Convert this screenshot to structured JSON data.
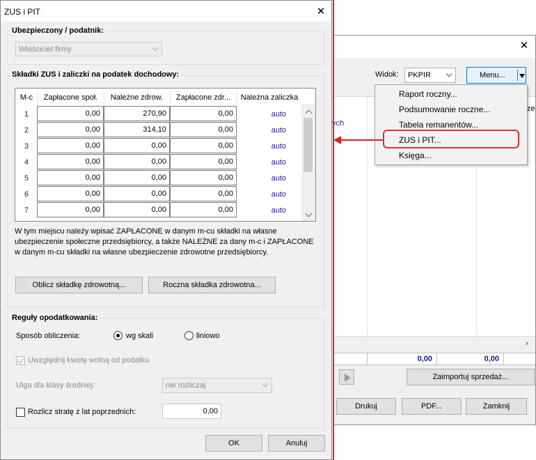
{
  "bg_window": {
    "close": "✕",
    "view_label": "Widok:",
    "view_value": "PKPIR",
    "menu_button": "Menu...",
    "menu_items": [
      "Raport roczny...",
      "Podsumowanie roczne...",
      "Tabela remanentów...",
      "ZUS i PIT...",
      "Księga..."
    ],
    "partial_text": "ych",
    "partial_text2": "ze",
    "sum1": "0,00",
    "sum2": "0,00",
    "import_button": "Zaimportuj sprzedaż...",
    "print_button": "Drukuj",
    "pdf_button": "PDF...",
    "close_button": "Zamknij"
  },
  "dialog": {
    "title": "ZUS i PIT",
    "close": "✕",
    "insured": {
      "group_title": "Ubezpieczony / podatnik:",
      "selected": "Właściciel firmy"
    },
    "contributions": {
      "group_title": "Składki ZUS i zaliczki na podatek dochodowy:",
      "columns": [
        "M-c",
        "Zapłacone społ.",
        "Należne zdrow.",
        "Zapłacone zdr...",
        "Należna zaliczka"
      ],
      "rows": [
        {
          "month": "1",
          "paid_social": "0,00",
          "due_health": "270,90",
          "paid_health": "0,00",
          "advance": "auto"
        },
        {
          "month": "2",
          "paid_social": "0,00",
          "due_health": "314,10",
          "paid_health": "0,00",
          "advance": "auto"
        },
        {
          "month": "3",
          "paid_social": "0,00",
          "due_health": "0,00",
          "paid_health": "0,00",
          "advance": "auto"
        },
        {
          "month": "4",
          "paid_social": "0,00",
          "due_health": "0,00",
          "paid_health": "0,00",
          "advance": "auto"
        },
        {
          "month": "5",
          "paid_social": "0,00",
          "due_health": "0,00",
          "paid_health": "0,00",
          "advance": "auto"
        },
        {
          "month": "6",
          "paid_social": "0,00",
          "due_health": "0,00",
          "paid_health": "0,00",
          "advance": "auto"
        },
        {
          "month": "7",
          "paid_social": "0,00",
          "due_health": "0,00",
          "paid_health": "0,00",
          "advance": "auto"
        }
      ],
      "info_lines": [
        "W tym miejscu należy wpisać ZAPŁACONE w danym m-cu składki na własne",
        "ubezpieczenie społeczne przedsiębiorcy, a także NALEŻNE za dany m-c i ZAPŁACONE",
        "w danym m-cu składki na własne ubezpieczenie zdrowotne przedsiębiorcy."
      ],
      "calc_button": "Oblicz składkę zdrowotną...",
      "annual_button": "Roczna składka zdrowotna..."
    },
    "rules": {
      "group_title": "Reguły opodatkowania:",
      "method_label": "Sposób obliczenia:",
      "option_scale": "wg skali",
      "option_linear": "liniowo",
      "free_amount_label": "Uwzględnij kwotę wolną od podatku",
      "relief_label": "Ulga dla klasy średniej:",
      "relief_value": "nie rozliczaj",
      "loss_label": "Rozlicz stratę z lat poprzednich:",
      "loss_value": "0,00"
    },
    "ok_button": "OK",
    "cancel_button": "Anuluj"
  },
  "colors": {
    "accent": "#0078d7",
    "annotation": "#e02020",
    "link_text": "#1a1a8a"
  }
}
